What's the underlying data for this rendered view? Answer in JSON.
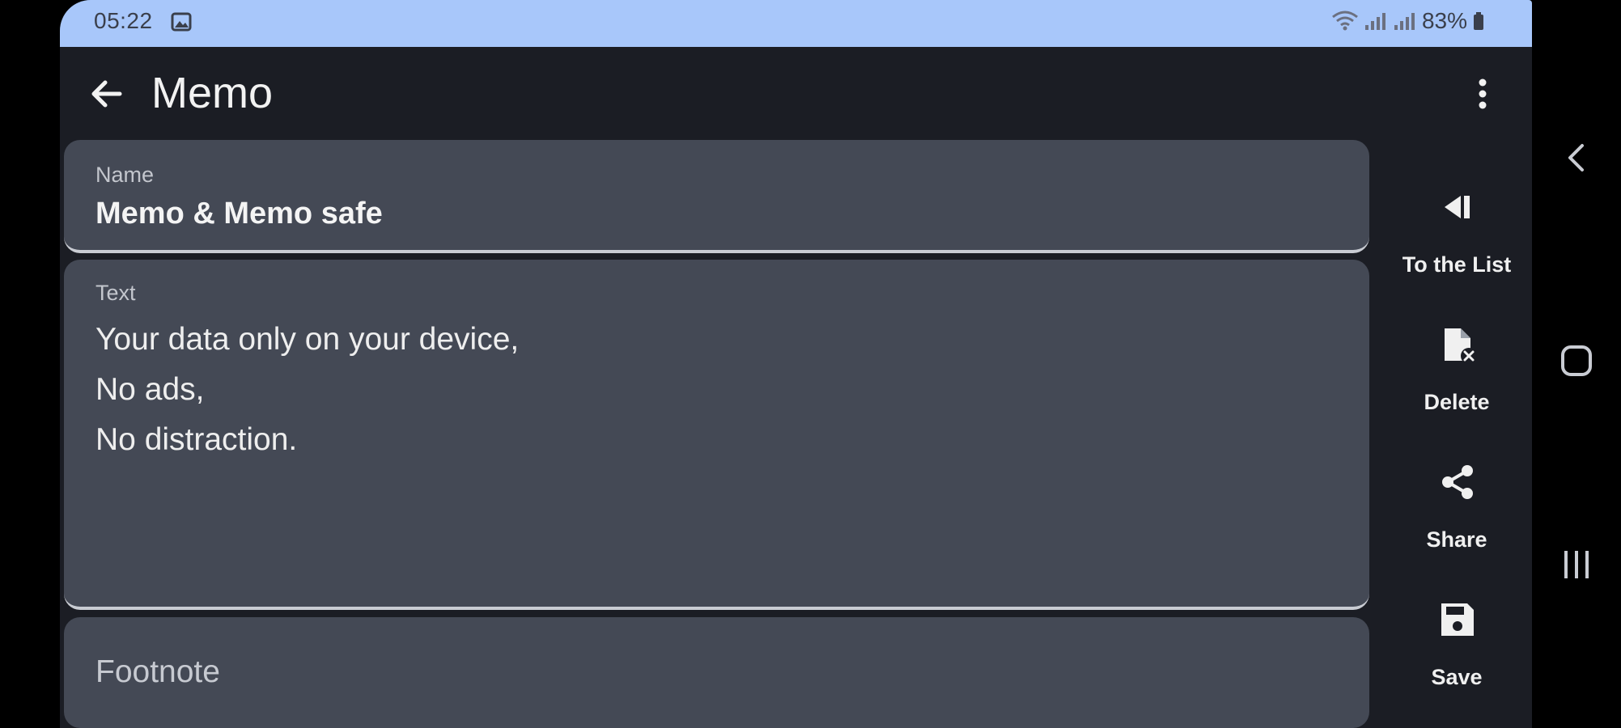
{
  "status_bar": {
    "time": "05:22",
    "battery": "83%",
    "icons": [
      "gallery-icon",
      "wifi-icon",
      "signal-icon",
      "signal-icon",
      "battery-icon"
    ]
  },
  "app_bar": {
    "title": "Memo",
    "back_icon": "arrow-back-icon",
    "menu_icon": "more-vert-icon"
  },
  "form": {
    "name": {
      "label": "Name",
      "value": "Memo & Memo safe"
    },
    "text": {
      "label": "Text",
      "lines": [
        "Your data only on your device,",
        "No ads,",
        "No distraction."
      ]
    },
    "footnote": {
      "placeholder": "Footnote"
    }
  },
  "actions": [
    {
      "label": "To the List",
      "icon": "to-list-icon"
    },
    {
      "label": "Delete",
      "icon": "delete-note-icon"
    },
    {
      "label": "Share",
      "icon": "share-icon"
    },
    {
      "label": "Save",
      "icon": "save-icon"
    }
  ],
  "system_nav": [
    "back-icon",
    "home-icon",
    "recents-icon"
  ],
  "colors": {
    "status_bar": "#a8c7fa",
    "background": "#1b1d24",
    "field": "#444955"
  }
}
